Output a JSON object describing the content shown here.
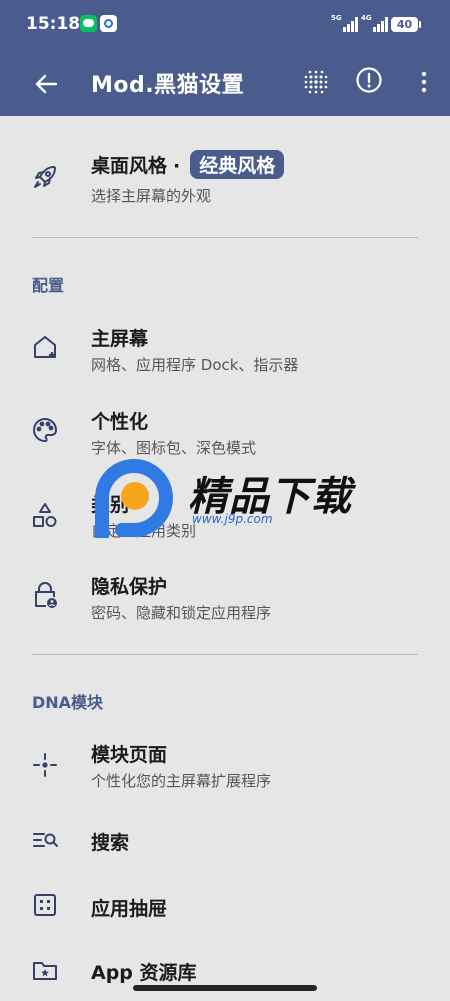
{
  "status_bar": {
    "time": "15:18",
    "signal1": "5G",
    "signal2": "4G",
    "battery": "40"
  },
  "app_bar": {
    "title": "Mod.黑猫设置",
    "back_icon": "arrow-left-icon",
    "grid_icon": "dot-grid-icon",
    "info_icon": "info-circle-icon",
    "more_icon": "more-vert-icon"
  },
  "theme_item": {
    "title": "桌面风格",
    "separator": "·",
    "chip": "经典风格",
    "subtitle": "选择主屏幕的外观",
    "icon": "rocket-icon"
  },
  "section_config": {
    "label": "配置"
  },
  "config_items": [
    {
      "title": "主屏幕",
      "subtitle": "网格、应用程序 Dock、指示器",
      "icon": "home-plus-icon"
    },
    {
      "title": "个性化",
      "subtitle": "字体、图标包、深色模式",
      "icon": "palette-icon"
    },
    {
      "title": "类别",
      "subtitle": "自定义应用类别",
      "icon": "category-shapes-icon"
    },
    {
      "title": "隐私保护",
      "subtitle": "密码、隐藏和锁定应用程序",
      "icon": "lock-person-icon"
    }
  ],
  "section_dna": {
    "label": "DNA模块"
  },
  "dna_items": [
    {
      "title": "模块页面",
      "subtitle": "个性化您的主屏幕扩展程序",
      "icon": "crosshair-icon"
    },
    {
      "title": "搜索",
      "icon": "list-search-icon"
    },
    {
      "title": "应用抽屉",
      "icon": "app-drawer-icon"
    },
    {
      "title": "App 资源库",
      "icon": "folder-star-icon"
    }
  ],
  "watermark": {
    "text": "精品下载",
    "url": "www.j9p.com"
  },
  "colors": {
    "primary": "#4a5b8e",
    "background": "#e6e6e6",
    "watermark_orange": "#f7a51c",
    "watermark_blue": "#2f7be3"
  }
}
